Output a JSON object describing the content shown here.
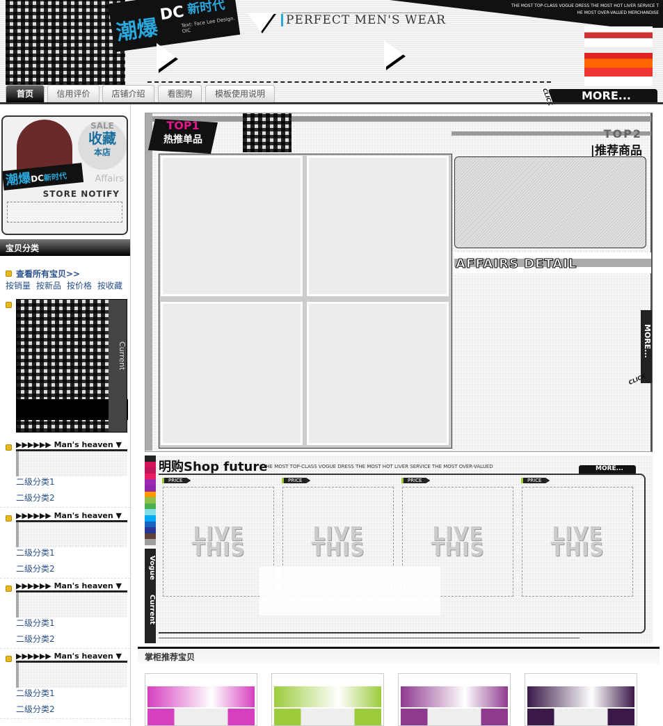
{
  "header": {
    "logo_cn": "潮爆",
    "logo_dc": "DC",
    "logo_cn2": "新时代",
    "logo_sub": "Text: Face Lee Design. OIC",
    "tagline": "PERFECT MEN'S WEAR",
    "promo_line1": "THE MOST TOP-CLASS VOGUE DRESS THE MOST HOT LIVER SERVICE T",
    "promo_line2": "HE MOST OVER-VALUED MERCHANDISE",
    "more": "MORE...",
    "click": "CLICK"
  },
  "nav": {
    "tabs": [
      {
        "label": "首页"
      },
      {
        "label": "信用评价"
      },
      {
        "label": "店铺介绍"
      },
      {
        "label": "看图购"
      },
      {
        "label": "模板使用说明"
      }
    ]
  },
  "sidebar": {
    "notify": {
      "sale": "SALE",
      "fav": "收藏",
      "store": "本店",
      "affairs": "Affairs",
      "store_notify": "STORE NOTIFY"
    },
    "category_title": "宝贝分类",
    "view_all": "查看所有宝贝>>",
    "sorts": [
      "按销量",
      "按新品",
      "按价格",
      "按收藏"
    ],
    "promo_side": "Current",
    "groups": [
      {
        "title": "▶▶▶▶▶▶ Man's heaven ▼",
        "items": [
          "二级分类1",
          "二级分类2"
        ]
      },
      {
        "title": "▶▶▶▶▶▶ Man's heaven ▼",
        "items": [
          "二级分类1",
          "二级分类2"
        ]
      },
      {
        "title": "▶▶▶▶▶▶ Man's heaven ▼",
        "items": [
          "二级分类1",
          "二级分类2"
        ]
      },
      {
        "title": "▶▶▶▶▶▶ Man's heaven ▼",
        "items": [
          "二级分类1",
          "二级分类2"
        ]
      }
    ]
  },
  "top": {
    "top1": "TOP1",
    "top1_cn": "热推单品",
    "top2": "TOP2",
    "top2_cn": "|推荐商品",
    "affairs": "AFFAIRS DETAIL",
    "more": "MORE...",
    "click": "CLICK"
  },
  "shop": {
    "title_cn": "明购",
    "title_en": "Shop  future",
    "slogan": "THE MOST TOP-CLASS VOGUE DRESS THE MOST HOT LIVER SERVICE THE MOST OVER-VALUED",
    "more": "MORE...",
    "side1": "Vogue",
    "side2": "Current",
    "price": "PRICE",
    "placeholder_line1": "LIVE",
    "placeholder_line2": "THIS",
    "swatches": [
      "#222222",
      "#d4145a",
      "#c2185b",
      "#e91e63",
      "#9c27b0",
      "#8e24aa",
      "#ff9800",
      "#8bc34a",
      "#4caf50",
      "#80deea",
      "#03a9f4",
      "#1565c0",
      "#283593",
      "#5d4037",
      "#9e9e9e"
    ]
  },
  "recommend": {
    "title": "掌柜推荐宝贝",
    "thumb_colors": [
      "#d63fbf",
      "#9ccc3c",
      "#8e3a8e",
      "#3a1848"
    ]
  }
}
